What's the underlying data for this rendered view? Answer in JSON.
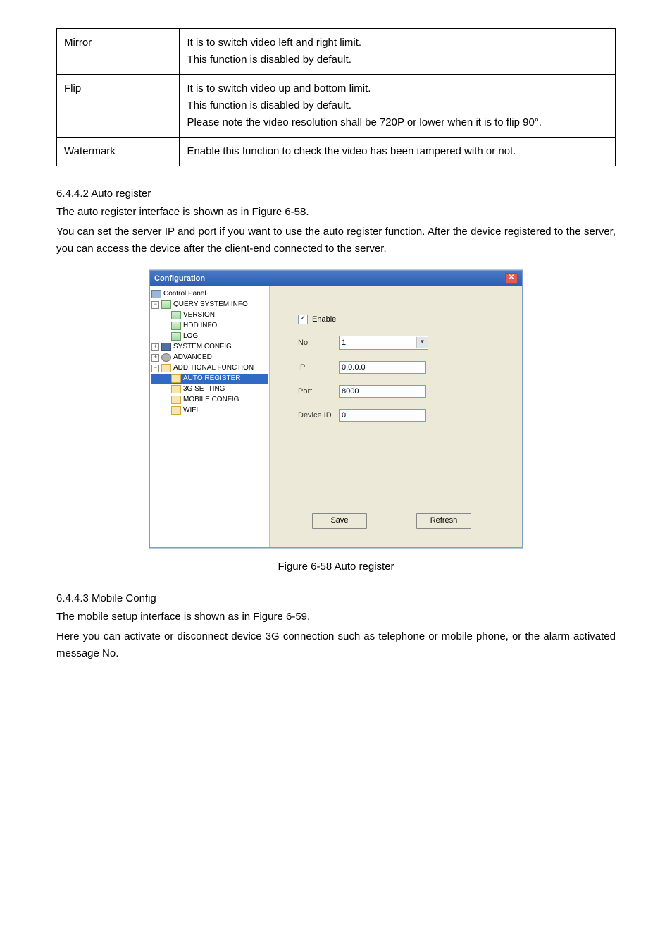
{
  "params_table": {
    "rows": [
      {
        "name": "Mirror",
        "desc_lines": [
          "It is to switch video left and right limit.",
          "This function is disabled by default."
        ]
      },
      {
        "name": "Flip",
        "desc_lines": [
          "It is to switch video up and bottom limit.",
          "This function is disabled by default.",
          "Please note the video resolution shall be 720P or lower when it is to flip 90°."
        ]
      },
      {
        "name": "Watermark",
        "desc_lines": [
          "Enable this function to check the video has been tampered with or not."
        ]
      }
    ]
  },
  "section_auto": {
    "num": "6.4.4.2 Auto register",
    "p1": "The auto register interface is shown as in Figure 6-58.",
    "p2": "You can set the server IP and port if you want to use the auto register function. After the device registered to the server, you can access the device after the client-end connected to the server."
  },
  "figure_caption": "Figure 6-58 Auto register",
  "section_mobile": {
    "num": "6.4.4.3 Mobile Config",
    "p1": "The mobile setup interface is shown as in Figure 6-59.",
    "p2": "Here you can activate or disconnect device 3G connection such as telephone or mobile phone, or the alarm activated message No."
  },
  "config_window": {
    "title": "Configuration",
    "close_glyph": "✕",
    "tree": {
      "control_panel": "Control Panel",
      "query_sys": "QUERY SYSTEM INFO",
      "version": "VERSION",
      "hdd": "HDD INFO",
      "log": "LOG",
      "sys_cfg": "SYSTEM CONFIG",
      "advanced": "ADVANCED",
      "add_func": "ADDITIONAL FUNCTION",
      "auto_reg": "AUTO REGISTER",
      "g3": "3G SETTING",
      "mobile": "MOBILE CONFIG",
      "wifi": "WIFI"
    },
    "form": {
      "enable_label": "Enable",
      "enable_checked": "✓",
      "no_label": "No.",
      "no_value": "1",
      "ip_label": "IP",
      "ip_value": "0.0.0.0",
      "port_label": "Port",
      "port_value": "8000",
      "devid_label": "Device ID",
      "devid_value": "0",
      "save": "Save",
      "refresh": "Refresh"
    }
  }
}
